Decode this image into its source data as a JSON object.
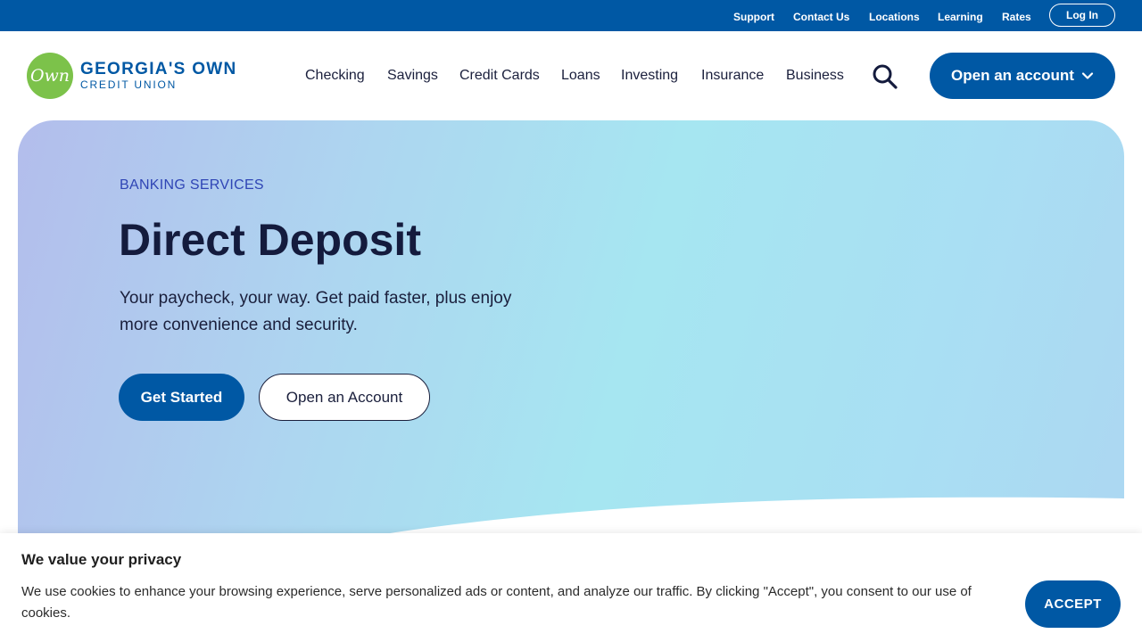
{
  "utility_nav": {
    "links": [
      "Support",
      "Contact Us",
      "Locations",
      "Learning",
      "Rates"
    ],
    "login_label": "Log In"
  },
  "brand": {
    "mark_text": "Own",
    "line1": "GEORGIA'S OWN",
    "line2": "CREDIT UNION"
  },
  "main_nav": {
    "items": [
      "Checking",
      "Savings",
      "Credit Cards",
      "Loans",
      "Investing",
      "Insurance",
      "Business"
    ],
    "search_icon": "search-icon",
    "open_account_label": "Open an account",
    "dropdown_icon": "chevron-down-icon"
  },
  "hero": {
    "eyebrow": "BANKING SERVICES",
    "title": "Direct Deposit",
    "description": "Your paycheck, your way. Get paid faster, plus enjoy more convenience and security.",
    "primary_cta": "Get Started",
    "secondary_cta": "Open an Account"
  },
  "cookie_banner": {
    "title": "We value your privacy",
    "text": "We use cookies to enhance your browsing experience, serve personalized ads or content, and analyze our traffic. By clicking \"Accept\", you consent to our use of cookies.",
    "accept_label": "ACCEPT"
  },
  "colors": {
    "brand_blue": "#0058a4",
    "brand_green": "#7cc24a",
    "text_dark": "#141b3d",
    "eyebrow_blue": "#2f45b5"
  }
}
